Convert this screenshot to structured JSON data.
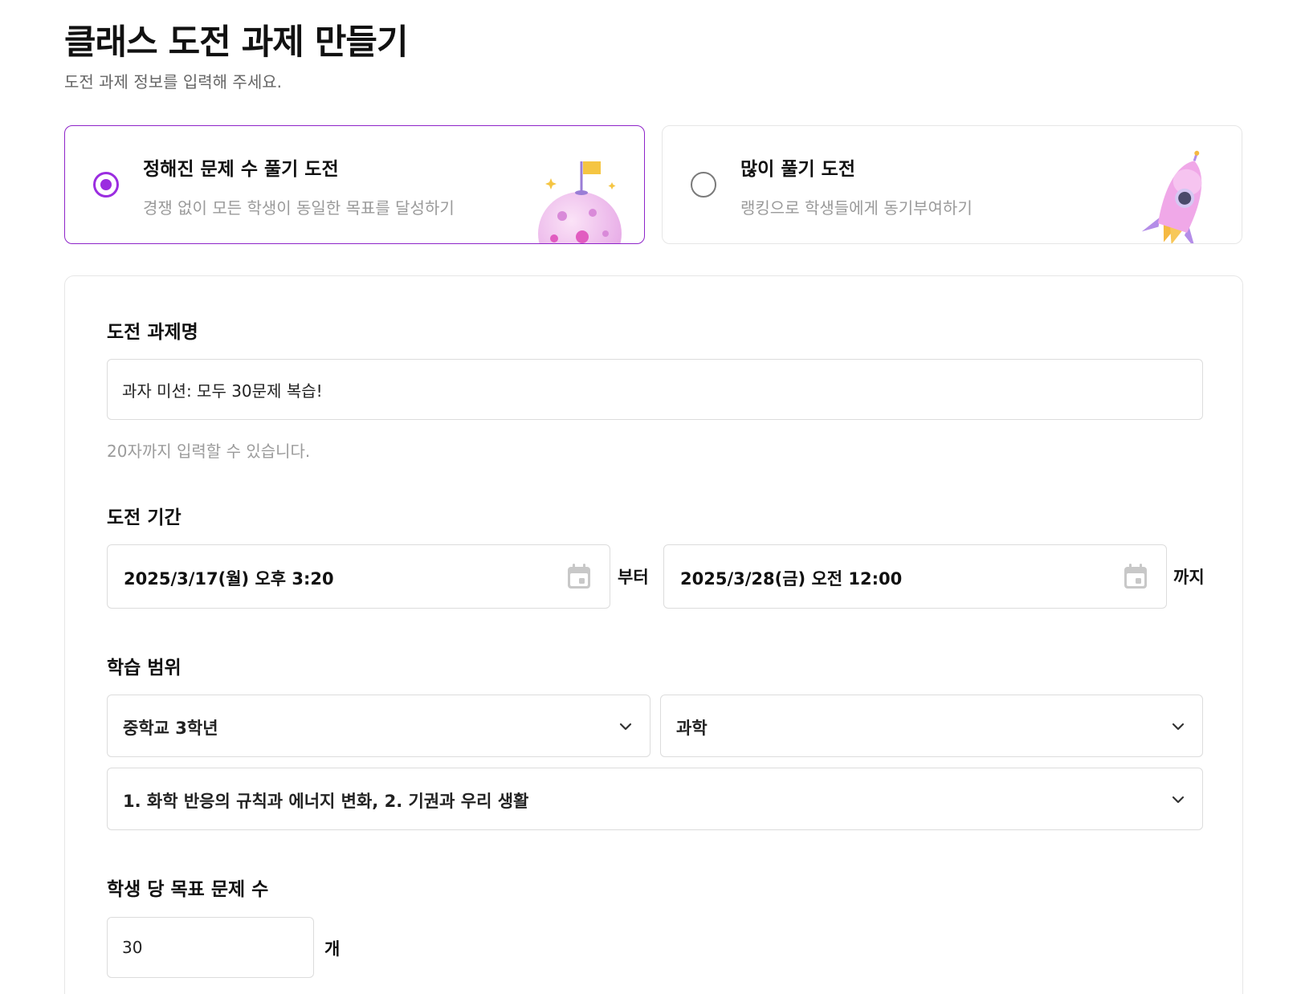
{
  "header": {
    "title": "클래스 도전 과제 만들기",
    "subtitle": "도전 과제 정보를 입력해 주세요."
  },
  "challenge_types": [
    {
      "title": "정해진 문제 수 풀기 도전",
      "description": "경쟁 없이 모든 학생이 동일한 목표를 달성하기",
      "selected": true,
      "illustration": "planet-flag-icon"
    },
    {
      "title": "많이 풀기 도전",
      "description": "랭킹으로 학생들에게 동기부여하기",
      "selected": false,
      "illustration": "rocket-icon"
    }
  ],
  "form": {
    "name": {
      "label": "도전 과제명",
      "value": "과자 미션: 모두 30문제 복습!",
      "hint": "20자까지 입력할 수 있습니다."
    },
    "period": {
      "label": "도전 기간",
      "start": "2025/3/17(월) 오후 3:20",
      "start_suffix": "부터",
      "end": "2025/3/28(금) 오전 12:00",
      "end_suffix": "까지"
    },
    "scope": {
      "label": "학습 범위",
      "grade": "중학교 3학년",
      "subject": "과학",
      "units": "1. 화학 반응의 규칙과 에너지 변화, 2. 기권과 우리 생활"
    },
    "target": {
      "label": "학생 당 목표 문제 수",
      "value": "30",
      "unit": "개"
    }
  },
  "colors": {
    "accent": "#9b2de0",
    "border": "#dcdcdc",
    "muted_text": "#9b9b9b"
  }
}
